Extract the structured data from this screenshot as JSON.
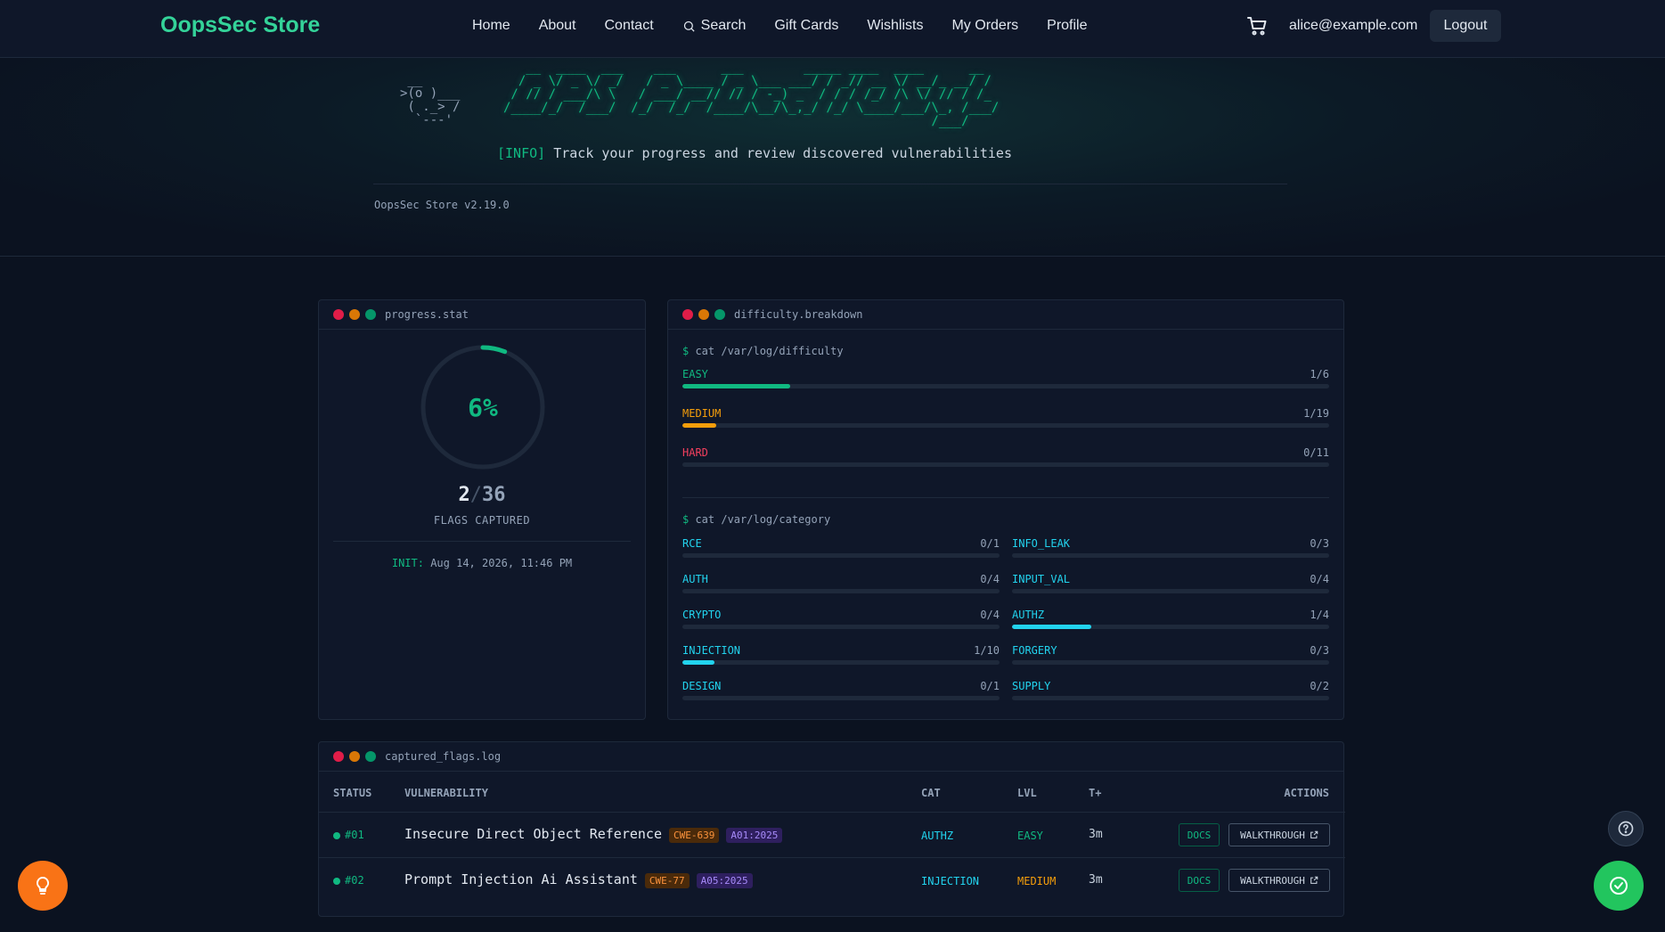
{
  "nav": {
    "brand": "OopsSec Store",
    "links": [
      "Home",
      "About",
      "Contact",
      "Search",
      "Gift Cards",
      "Wishlists",
      "My Orders",
      "Profile"
    ],
    "user_email": "alice@example.com",
    "logout_label": "Logout"
  },
  "hero": {
    "duck_art": " __\n>(o )___\n ( ._> /\n  `---'",
    "ascii_title": "   __  ____  ___    ___      ___        _____ ____  ____      __\n  / _ \\/ _ \\/ _/   / _ \\____ / _ \\___ ___/ / _// __ \\/ __/_ __/ /\n / // / ___/\\ \\   / ___/ __// // / -_) _  / / / /_/ /\\ \\/ // / /_\n/____/_/  /___/  /_/  /_/  /____/\\__/\\_,_/ /_/ \\____/___/\\_, /___/\n                                                         /___/",
    "info_tag": "[INFO]",
    "info_text": " Track your progress and review discovered vulnerabilities",
    "version": "OopsSec Store v2.19.0"
  },
  "progress": {
    "title": "progress.stat",
    "percent_label": "6%",
    "percent": 0.06,
    "captured": "2",
    "sep": "/",
    "total": "36",
    "caption": "FLAGS CAPTURED",
    "init_label": "INIT:",
    "init_value": "Aug 14, 2026, 11:46 PM"
  },
  "difficulty": {
    "title": "difficulty.breakdown",
    "prompt": "$",
    "cmd_difficulty": " cat /var/log/difficulty",
    "cmd_category": " cat /var/log/category",
    "levels": [
      {
        "label": "EASY",
        "value": "1/6",
        "fraction": 0.1667,
        "color": "#10b981"
      },
      {
        "label": "MEDIUM",
        "value": "1/19",
        "fraction": 0.0526,
        "color": "#f59e0b"
      },
      {
        "label": "HARD",
        "value": "0/11",
        "fraction": 0,
        "color": "#f43f5e"
      }
    ],
    "categories_left": [
      {
        "label": "RCE",
        "value": "0/1",
        "fraction": 0
      },
      {
        "label": "AUTH",
        "value": "0/4",
        "fraction": 0
      },
      {
        "label": "CRYPTO",
        "value": "0/4",
        "fraction": 0
      },
      {
        "label": "INJECTION",
        "value": "1/10",
        "fraction": 0.1
      },
      {
        "label": "DESIGN",
        "value": "0/1",
        "fraction": 0
      }
    ],
    "categories_right": [
      {
        "label": "INFO_LEAK",
        "value": "0/3",
        "fraction": 0
      },
      {
        "label": "INPUT_VAL",
        "value": "0/4",
        "fraction": 0
      },
      {
        "label": "AUTHZ",
        "value": "1/4",
        "fraction": 0.25
      },
      {
        "label": "FORGERY",
        "value": "0/3",
        "fraction": 0
      },
      {
        "label": "SUPPLY",
        "value": "0/2",
        "fraction": 0
      }
    ]
  },
  "flags_log": {
    "title": "captured_flags.log",
    "headers": {
      "status": "STATUS",
      "vulnerability": "VULNERABILITY",
      "cat": "CAT",
      "lvl": "LVL",
      "t": "T+",
      "actions": "ACTIONS"
    },
    "rows": [
      {
        "id": "#01",
        "name": "Insecure Direct Object Reference",
        "cwe": "CWE-639",
        "owasp": "A01:2025",
        "cat": "AUTHZ",
        "lvl": "EASY",
        "lvl_color": "#10b981",
        "t": "3m",
        "docs": "DOCS",
        "walkthrough": "WALKTHROUGH"
      },
      {
        "id": "#02",
        "name": "Prompt Injection Ai Assistant",
        "cwe": "CWE-77",
        "owasp": "A05:2025",
        "cat": "INJECTION",
        "lvl": "MEDIUM",
        "lvl_color": "#f59e0b",
        "t": "3m",
        "docs": "DOCS",
        "walkthrough": "WALKTHROUGH"
      }
    ]
  },
  "colors": {
    "accent": "#10b981",
    "category": "#22d3ee",
    "bg": "#0b1220"
  }
}
